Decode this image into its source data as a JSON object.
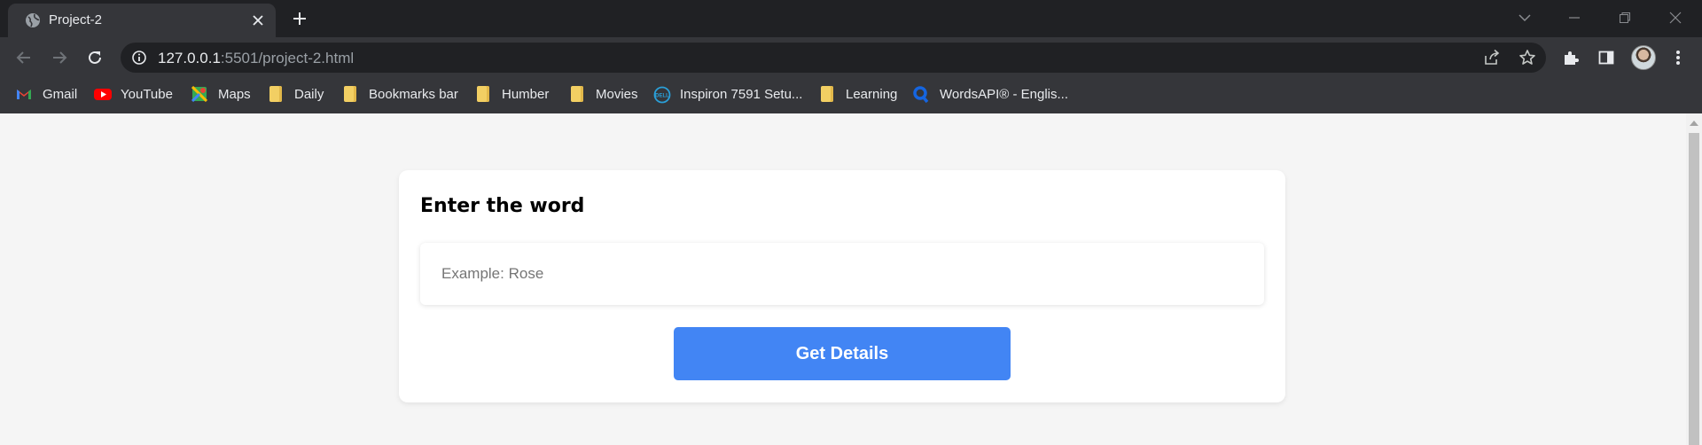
{
  "browser": {
    "tab_title": "Project-2",
    "url_host": "127.0.0.1",
    "url_path": ":5501/project-2.html",
    "bookmarks": [
      {
        "label": "Gmail",
        "icon": "gmail-icon"
      },
      {
        "label": "YouTube",
        "icon": "youtube-icon"
      },
      {
        "label": "Maps",
        "icon": "maps-icon"
      },
      {
        "label": "Daily",
        "icon": "folder-icon"
      },
      {
        "label": "Bookmarks bar",
        "icon": "folder-icon"
      },
      {
        "label": "Humber",
        "icon": "folder-icon"
      },
      {
        "label": "Movies",
        "icon": "folder-icon"
      },
      {
        "label": "Inspiron 7591 Setu...",
        "icon": "dell-icon"
      },
      {
        "label": "Learning",
        "icon": "folder-icon"
      },
      {
        "label": "WordsAPI® - Englis...",
        "icon": "wordsapi-icon"
      }
    ]
  },
  "page": {
    "card_title": "Enter the word",
    "input_placeholder": "Example: Rose",
    "input_value": "",
    "button_label": "Get Details"
  },
  "colors": {
    "primary_button": "#4285f4",
    "page_background": "#f5f5f5",
    "card_background": "#ffffff"
  }
}
